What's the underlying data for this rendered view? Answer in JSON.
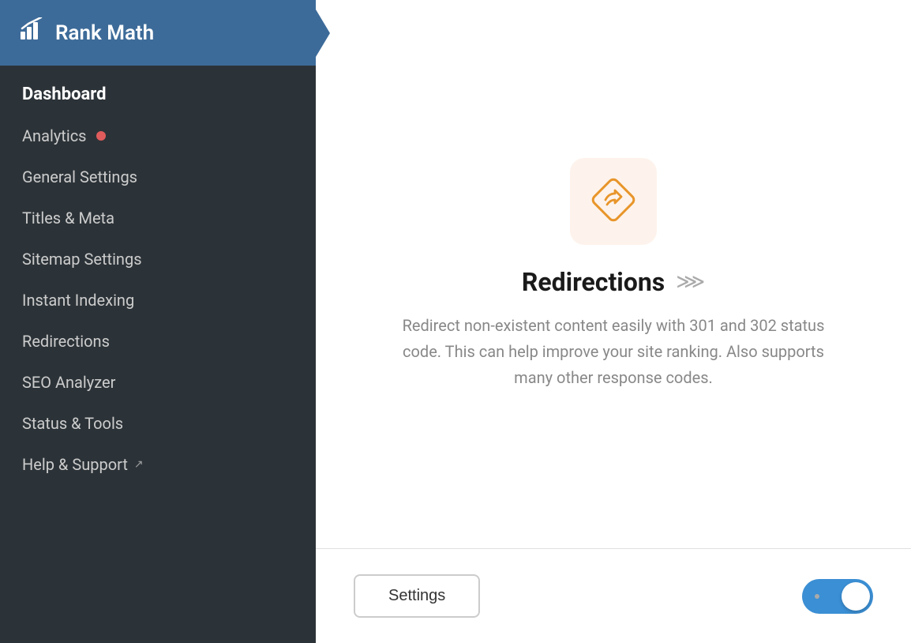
{
  "sidebar": {
    "title": "Rank Math",
    "logo_icon": "📊",
    "nav_items": [
      {
        "id": "dashboard",
        "label": "Dashboard",
        "active": true,
        "badge": false,
        "external": false
      },
      {
        "id": "analytics",
        "label": "Analytics",
        "active": false,
        "badge": true,
        "external": false
      },
      {
        "id": "general-settings",
        "label": "General Settings",
        "active": false,
        "badge": false,
        "external": false
      },
      {
        "id": "titles-meta",
        "label": "Titles & Meta",
        "active": false,
        "badge": false,
        "external": false
      },
      {
        "id": "sitemap-settings",
        "label": "Sitemap Settings",
        "active": false,
        "badge": false,
        "external": false
      },
      {
        "id": "instant-indexing",
        "label": "Instant Indexing",
        "active": false,
        "badge": false,
        "external": false
      },
      {
        "id": "redirections",
        "label": "Redirections",
        "active": false,
        "badge": false,
        "external": false
      },
      {
        "id": "seo-analyzer",
        "label": "SEO Analyzer",
        "active": false,
        "badge": false,
        "external": false
      },
      {
        "id": "status-tools",
        "label": "Status & Tools",
        "active": false,
        "badge": false,
        "external": false
      },
      {
        "id": "help-support",
        "label": "Help & Support",
        "active": false,
        "badge": false,
        "external": true
      }
    ]
  },
  "main": {
    "card": {
      "title": "Redirections",
      "description": "Redirect non-existent content easily with 301 and 302 status code. This can help improve your site ranking. Also supports many other response codes.",
      "settings_label": "Settings",
      "toggle_enabled": true
    }
  }
}
